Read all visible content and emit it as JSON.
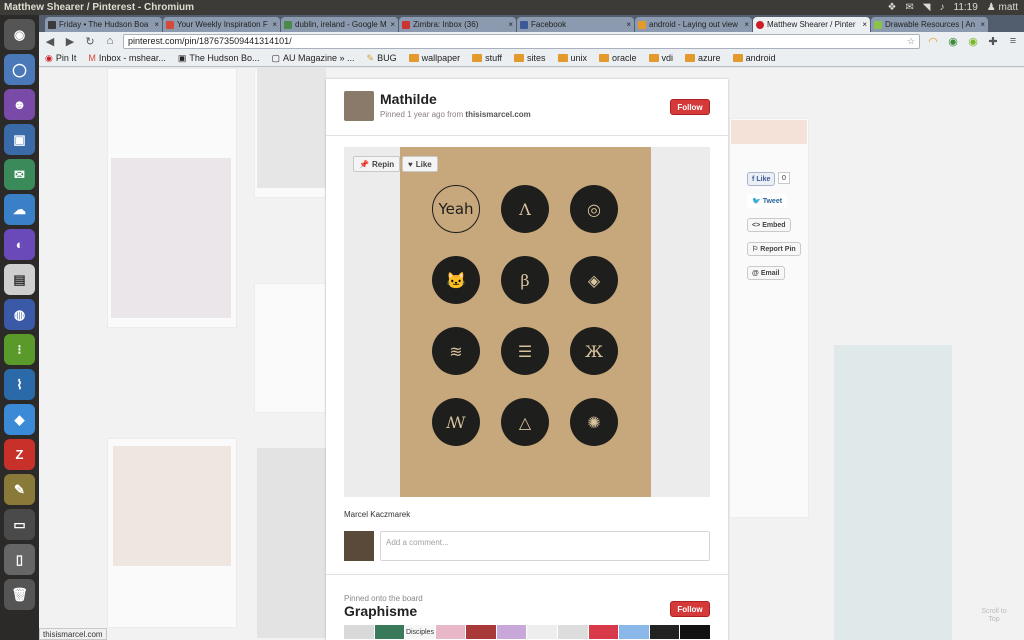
{
  "panel": {
    "window_title": "Matthew Shearer / Pinterest - Chromium",
    "time": "11:19",
    "user": "matt"
  },
  "tabs": [
    {
      "label": "Friday • The Hudson Boa",
      "color": "#3a3a3a"
    },
    {
      "label": "Your Weekly Inspiration F",
      "color": "#d44a3a"
    },
    {
      "label": "dublin, ireland - Google M",
      "color": "#4a8a4a"
    },
    {
      "label": "Zimbra: Inbox (36)",
      "color": "#c33"
    },
    {
      "label": "Facebook",
      "color": "#3b5998"
    },
    {
      "label": "android - Laying out view",
      "color": "#e39a2c"
    },
    {
      "label": "Matthew Shearer / Pinter",
      "color": "#cb2027"
    },
    {
      "label": "Drawable Resources | An",
      "color": "#8bc34a"
    }
  ],
  "toolbar": {
    "url": "pinterest.com/pin/187673509441314101/"
  },
  "bookmarks": [
    {
      "label": "Pin It",
      "kind": "page"
    },
    {
      "label": "Inbox - mshear...",
      "kind": "page"
    },
    {
      "label": "The Hudson Bo...",
      "kind": "page"
    },
    {
      "label": "AU Magazine » ...",
      "kind": "page"
    },
    {
      "label": "BUG",
      "kind": "page"
    },
    {
      "label": "wallpaper",
      "kind": "folder"
    },
    {
      "label": "stuff",
      "kind": "folder"
    },
    {
      "label": "sites",
      "kind": "folder"
    },
    {
      "label": "unix",
      "kind": "folder"
    },
    {
      "label": "oracle",
      "kind": "folder"
    },
    {
      "label": "vdi",
      "kind": "folder"
    },
    {
      "label": "azure",
      "kind": "folder"
    },
    {
      "label": "android",
      "kind": "folder"
    }
  ],
  "pin": {
    "pinner_name": "Mathilde",
    "pinned_prefix": "Pinned 1 year ago from",
    "pinned_source": "thisismarcel.com",
    "follow_label": "Follow",
    "repin_label": "Repin",
    "like_label": "Like",
    "source_name": "Marcel Kaczmarek",
    "comment_placeholder": "Add a comment...",
    "poster_glyphs": [
      "Yeah",
      "Λ",
      "◎",
      "🐱",
      "β",
      "◈",
      "≋",
      "☰",
      "Ж",
      "ꟿ",
      "△",
      "✺"
    ]
  },
  "board": {
    "label": "Pinned onto the board",
    "name": "Graphisme",
    "follow_label": "Follow",
    "thumb_text": "Disciples"
  },
  "share": {
    "fb_like": "Like",
    "fb_count": "0",
    "tweet": "Tweet",
    "embed": "Embed",
    "report": "Report Pin",
    "email": "Email"
  },
  "status_bar": "thisismarcel.com",
  "scroll_top": "Scroll to Top"
}
